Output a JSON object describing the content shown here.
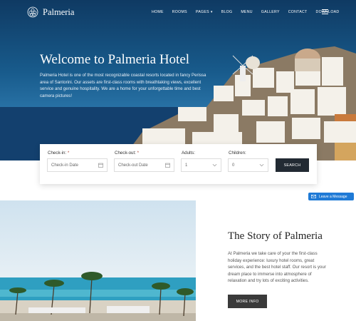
{
  "brand": {
    "name": "Palmeria",
    "logo_icon": "flower-logo-icon"
  },
  "nav": {
    "items": [
      {
        "label": "HOME"
      },
      {
        "label": "ROOMS"
      },
      {
        "label": "PAGES"
      },
      {
        "label": "BLOG"
      },
      {
        "label": "MENU"
      },
      {
        "label": "GALLERY"
      },
      {
        "label": "CONTACT"
      },
      {
        "label": "DOWNLOAD"
      }
    ],
    "dropdown_caret": "▾"
  },
  "hero": {
    "title": "Welcome to Palmeria Hotel",
    "text": "Palmeria Hotel is one of the most recognizable coastal resorts located in fancy Perissa area of Santorini. Our assets are first-class rooms with breathtaking views, excellent service and genuine hospitality. We are a home for your unforgettable time and best camera pictures!"
  },
  "booking": {
    "checkin": {
      "label": "Check-in:",
      "required": "*",
      "placeholder": "Check-in Date"
    },
    "checkout": {
      "label": "Check-out:",
      "required": "*",
      "placeholder": "Check-out Date"
    },
    "adults": {
      "label": "Adults:",
      "value": "1"
    },
    "children": {
      "label": "Children:",
      "value": "0"
    },
    "search_label": "SEARCH"
  },
  "leave_message": {
    "label": "Leave a Message"
  },
  "story": {
    "title": "The Story of Palmeria",
    "text": "At Palmeria we take care of your the first-class holiday experience: luxury hotel rooms, great services, and the best hotel staff. Our resort is your dream place to immerse into atmosphere of relaxation and try lots of exciting activities.",
    "button_label": "MORE INFO"
  },
  "colors": {
    "accent_blue": "#1f7ad6",
    "dark_button": "#222a33",
    "required_red": "#b04a3a"
  }
}
